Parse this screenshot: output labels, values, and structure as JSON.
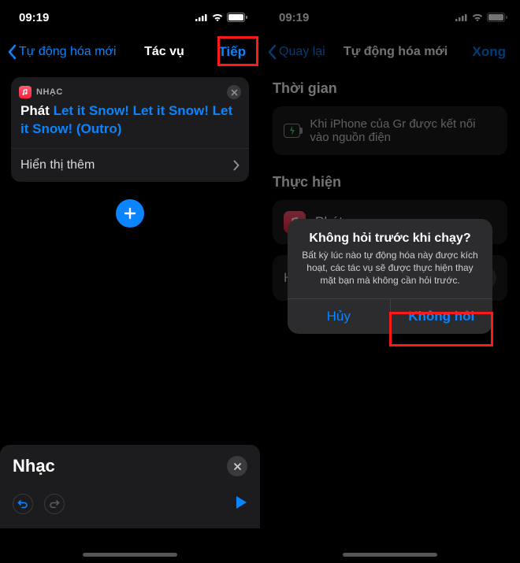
{
  "left": {
    "status_time": "09:19",
    "nav_back": "Tự động hóa mới",
    "nav_title": "Tác vụ",
    "nav_action": "Tiếp",
    "card": {
      "app_label": "NHẠC",
      "play_prefix": "Phát",
      "song": "Let it Snow! Let it Snow! Let it Snow! (Outro)",
      "show_more": "Hiển thị thêm"
    },
    "music_bar_title": "Nhạc"
  },
  "right": {
    "status_time": "09:19",
    "nav_back": "Quay lại",
    "nav_title": "Tự động hóa mới",
    "nav_action": "Xong",
    "section_when": "Thời gian",
    "when_row": "Khi iPhone của Gr được kết nối vào nguồn điện",
    "section_do": "Thực hiện",
    "do_row": "Phát",
    "ask_row": "Hỏi trước khi chạy",
    "alert": {
      "title": "Không hỏi trước khi chạy?",
      "message": "Bất kỳ lúc nào tự động hóa này được kích hoạt, các tác vụ sẽ được thực hiện thay mặt bạn mà không cần hỏi trước.",
      "cancel": "Hủy",
      "confirm": "Không hỏi"
    }
  }
}
